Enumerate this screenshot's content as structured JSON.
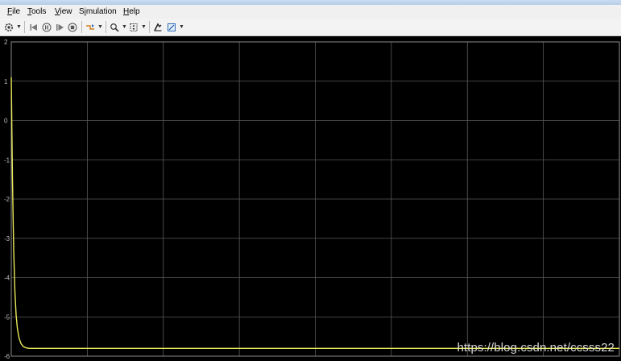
{
  "menubar": {
    "items": [
      {
        "label": "File",
        "underline": "F"
      },
      {
        "label": "Tools",
        "underline": "T"
      },
      {
        "label": "View",
        "underline": "V"
      },
      {
        "label": "Simulation",
        "underline": "i"
      },
      {
        "label": "Help",
        "underline": "H"
      }
    ]
  },
  "toolbar": {
    "icons": [
      "settings-gear-icon",
      "step-back-icon",
      "pause-icon",
      "step-forward-icon",
      "stop-icon",
      "highlight-icon",
      "zoom-icon",
      "autoscale-icon",
      "style-icon",
      "measure-icon"
    ]
  },
  "colors": {
    "plot_background": "#000000",
    "grid": "#5a5a5a",
    "signal": "#e8e85a"
  },
  "chart_data": {
    "type": "line",
    "title": "",
    "xlabel": "",
    "ylabel": "",
    "ylim": [
      -6,
      2
    ],
    "yticks": [
      2,
      1,
      0,
      -1,
      -2,
      -3,
      -4,
      -5,
      -6
    ],
    "grid": true,
    "series": [
      {
        "name": "",
        "color": "#e8e85a",
        "x": [
          0,
          0.01,
          0.02,
          0.03,
          0.04,
          0.06,
          0.08,
          0.1,
          0.13,
          0.16,
          0.2,
          0.25,
          0.3,
          0.4,
          0.5,
          0.7,
          1.0,
          10.0
        ],
        "y": [
          1.1,
          -0.3,
          -1.5,
          -2.5,
          -3.3,
          -4.35,
          -4.95,
          -5.3,
          -5.55,
          -5.68,
          -5.76,
          -5.79,
          -5.8,
          -5.8,
          -5.8,
          -5.8,
          -5.8,
          -5.8
        ]
      }
    ],
    "x_range": [
      0,
      10
    ]
  },
  "watermark": "https://blog.csdn.net/ccsss22"
}
